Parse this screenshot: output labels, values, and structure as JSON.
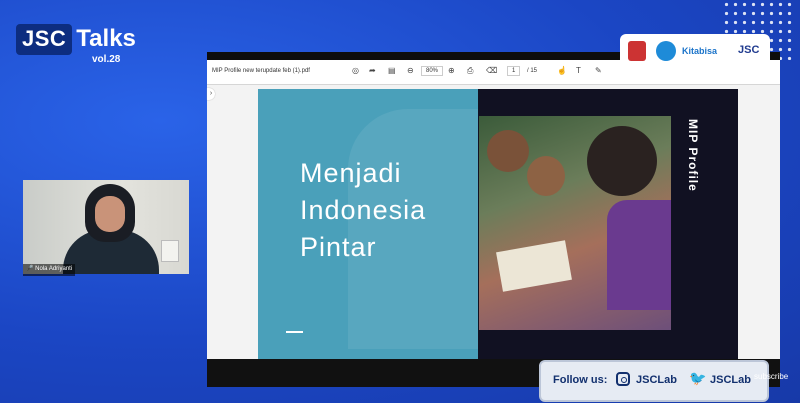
{
  "brand": {
    "show_name": "JSC",
    "show_suffix": "Talks",
    "volume": "vol.28"
  },
  "webcam": {
    "speaker_name": "Nola Adriyanti"
  },
  "pdf_viewer": {
    "filename": "MIP Profile new terupdate feb (1).pdf",
    "zoom": "80%",
    "current_page": "1",
    "total_pages": "/ 15"
  },
  "slide": {
    "title_lines": [
      "Menjadi",
      "Indonesia",
      "Pintar"
    ],
    "vertical_label": "MIP Profile"
  },
  "partners": {
    "kitabisa": "Kitabisa",
    "jsc": "JSC"
  },
  "follow_bar": {
    "label": "Follow us:",
    "instagram_handle": "JSCLab",
    "twitter_handle": "JSCLab"
  },
  "overlay": {
    "subscribe": "subscribe"
  },
  "colors": {
    "background": "#1f4fd0",
    "slide_teal": "#4aa0ba",
    "slide_dark": "#111122"
  }
}
